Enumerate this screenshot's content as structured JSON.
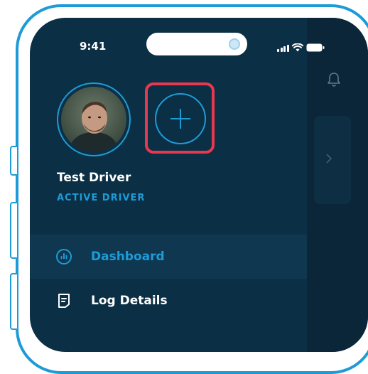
{
  "status_bar": {
    "time": "9:41"
  },
  "profile": {
    "name": "Test Driver",
    "status": "ACTIVE DRIVER"
  },
  "menu": [
    {
      "label": "Dashboard",
      "icon": "chart-circle-icon",
      "active": true
    },
    {
      "label": "Log Details",
      "icon": "document-icon",
      "active": false
    }
  ],
  "colors": {
    "background": "#0b2f44",
    "accent": "#1e9bd7",
    "highlight": "#e8384f",
    "text": "#ffffff"
  }
}
